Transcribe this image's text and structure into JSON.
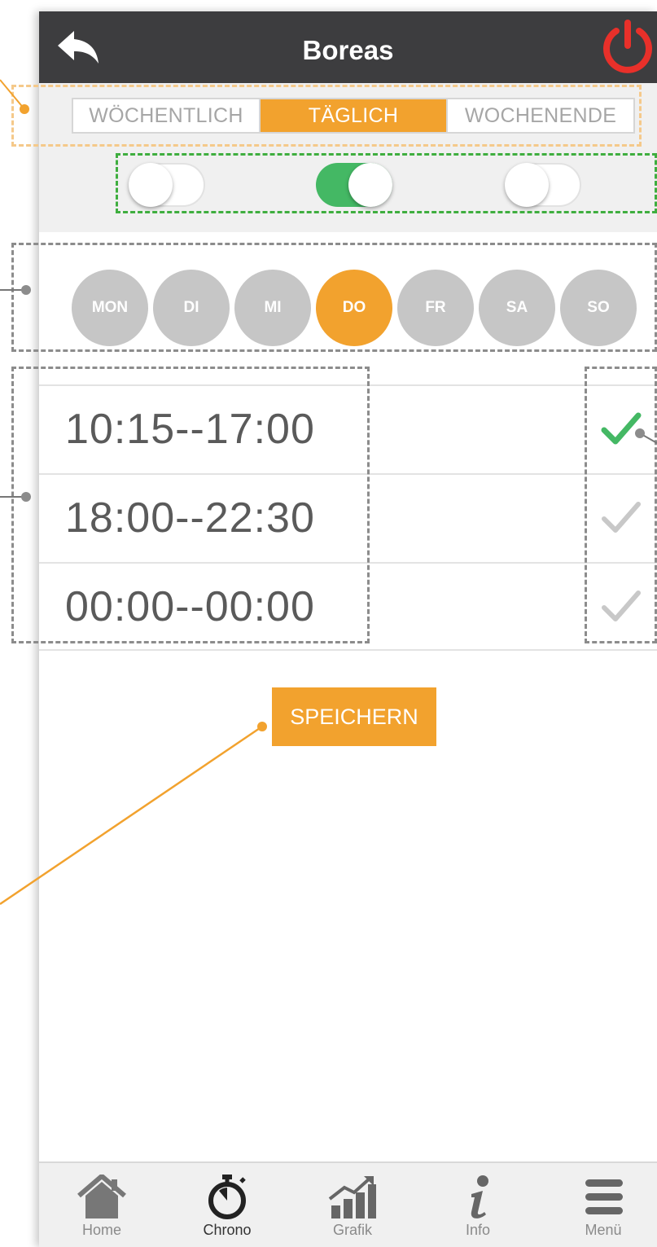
{
  "header": {
    "title": "Boreas"
  },
  "mode_tabs": [
    {
      "label": "WÖCHENTLICH",
      "active": false
    },
    {
      "label": "TÄGLICH",
      "active": true
    },
    {
      "label": "WOCHENENDE",
      "active": false
    }
  ],
  "toggles": [
    {
      "state": "off"
    },
    {
      "state": "on"
    },
    {
      "state": "off"
    }
  ],
  "days": [
    {
      "label": "MON",
      "active": false
    },
    {
      "label": "DI",
      "active": false
    },
    {
      "label": "MI",
      "active": false
    },
    {
      "label": "DO",
      "active": true
    },
    {
      "label": "FR",
      "active": false
    },
    {
      "label": "SA",
      "active": false
    },
    {
      "label": "SO",
      "active": false
    }
  ],
  "time_slots": [
    {
      "time": "10:15--17:00",
      "enabled": true
    },
    {
      "time": "18:00--22:30",
      "enabled": false
    },
    {
      "time": "00:00--00:00",
      "enabled": false
    }
  ],
  "save_label": "SPEICHERN",
  "bottom_nav": [
    {
      "label": "Home",
      "icon": "home-icon",
      "active": false
    },
    {
      "label": "Chrono",
      "icon": "stopwatch-icon",
      "active": true
    },
    {
      "label": "Grafik",
      "icon": "chart-icon",
      "active": false
    },
    {
      "label": "Info",
      "icon": "info-icon",
      "active": false
    },
    {
      "label": "Menü",
      "icon": "menu-icon",
      "active": false
    }
  ],
  "colors": {
    "accent": "#f2a22e",
    "header_bg": "#3d3d3f",
    "toggle_on": "#44b864",
    "check_on": "#44b864",
    "check_off": "#c8c8c8",
    "power": "#e8302a"
  }
}
